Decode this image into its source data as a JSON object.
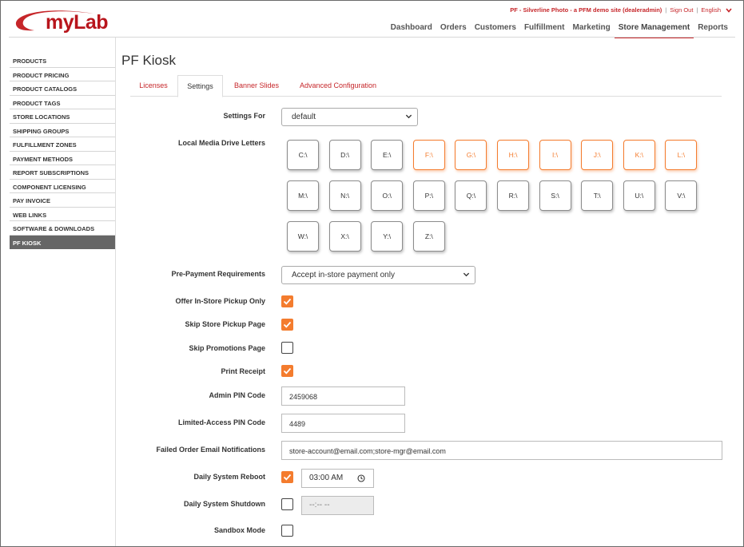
{
  "header": {
    "logo_text": "myLab",
    "site_label": "PF - Silverline Photo - a PFM demo site (dealeradmin)",
    "separator": "|",
    "sign_out": "Sign Out",
    "language": "English",
    "nav": [
      "Dashboard",
      "Orders",
      "Customers",
      "Fulfillment",
      "Marketing",
      "Store Management",
      "Reports"
    ],
    "active_nav": "Store Management"
  },
  "sidebar": {
    "items": [
      "PRODUCTS",
      "PRODUCT PRICING",
      "PRODUCT CATALOGS",
      "PRODUCT TAGS",
      "STORE LOCATIONS",
      "SHIPPING GROUPS",
      "FULFILLMENT ZONES",
      "PAYMENT METHODS",
      "REPORT SUBSCRIPTIONS",
      "COMPONENT LICENSING",
      "PAY INVOICE",
      "WEB LINKS",
      "SOFTWARE & DOWNLOADS",
      "PF KIOSK"
    ],
    "active": "PF KIOSK"
  },
  "page": {
    "title": "PF Kiosk",
    "tabs": [
      "Licenses",
      "Settings",
      "Banner Slides",
      "Advanced Configuration"
    ],
    "active_tab": "Settings"
  },
  "form": {
    "settings_for": {
      "label": "Settings For",
      "value": "default"
    },
    "drive_letters": {
      "label": "Local Media Drive Letters",
      "drives": [
        "C:\\",
        "D:\\",
        "E:\\",
        "F:\\",
        "G:\\",
        "H:\\",
        "I:\\",
        "J:\\",
        "K:\\",
        "L:\\",
        "M:\\",
        "N:\\",
        "O:\\",
        "P:\\",
        "Q:\\",
        "R:\\",
        "S:\\",
        "T:\\",
        "U:\\",
        "V:\\",
        "W:\\",
        "X:\\",
        "Y:\\",
        "Z:\\"
      ],
      "selected": [
        "F:\\",
        "G:\\",
        "H:\\",
        "I:\\",
        "J:\\",
        "K:\\",
        "L:\\"
      ]
    },
    "pre_payment": {
      "label": "Pre-Payment Requirements",
      "value": "Accept in-store payment only"
    },
    "offer_pickup": {
      "label": "Offer In-Store Pickup Only",
      "checked": true
    },
    "skip_pickup_page": {
      "label": "Skip Store Pickup Page",
      "checked": true
    },
    "skip_promotions": {
      "label": "Skip Promotions Page",
      "checked": false
    },
    "print_receipt": {
      "label": "Print Receipt",
      "checked": true
    },
    "admin_pin": {
      "label": "Admin PIN Code",
      "value": "2459068"
    },
    "limited_pin": {
      "label": "Limited-Access PIN Code",
      "value": "4489"
    },
    "failed_email": {
      "label": "Failed Order Email Notifications",
      "value": "store-account@email.com;store-mgr@email.com"
    },
    "daily_reboot": {
      "label": "Daily System Reboot",
      "checked": true,
      "time": "03:00 AM"
    },
    "daily_shutdown": {
      "label": "Daily System Shutdown",
      "checked": false,
      "time": "--:-- --"
    },
    "sandbox": {
      "label": "Sandbox Mode",
      "checked": false
    }
  },
  "colors": {
    "accent": "#c6262a",
    "orange": "#f47c2e",
    "sidebar_active": "#666666"
  },
  "icons": {
    "dropdown": "chevron-down-icon",
    "clock": "clock-icon",
    "check": "checkmark-icon",
    "lang": "chevron-down-icon"
  }
}
